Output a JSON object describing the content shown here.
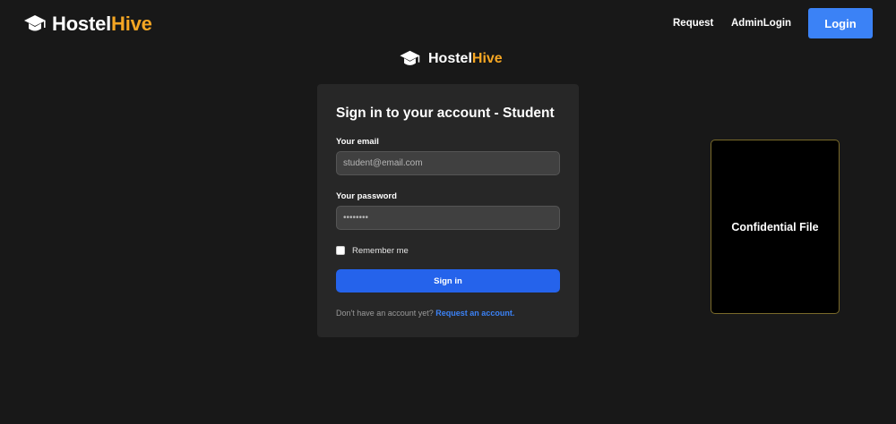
{
  "navbar": {
    "brand_primary": "Hostel",
    "brand_accent": "Hive",
    "links": {
      "request": "Request",
      "admin_login": "AdminLogin"
    },
    "login_button": "Login"
  },
  "center_logo": {
    "primary": "Hostel",
    "accent": "Hive"
  },
  "form": {
    "title": "Sign in to your account - Student",
    "email_label": "Your email",
    "email_placeholder": "student@email.com",
    "password_label": "Your password",
    "password_placeholder": "••••••••",
    "remember_label": "Remember me",
    "submit_label": "Sign in",
    "footer_text": "Don't have an account yet? ",
    "footer_link": "Request an account."
  },
  "side_card": {
    "label": "Confidential File"
  },
  "colors": {
    "background": "#181818",
    "accent": "#f5a623",
    "primary_button": "#2563eb",
    "link": "#3b82f6"
  },
  "icons": {
    "brand": "graduation-cap-icon"
  }
}
